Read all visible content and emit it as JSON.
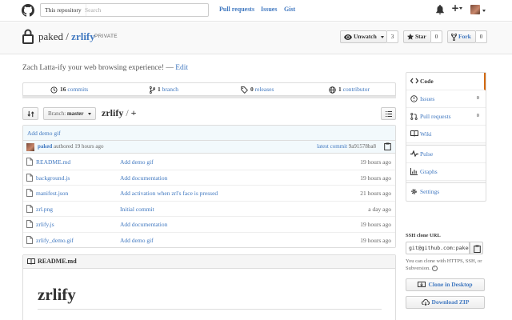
{
  "header": {
    "search_scope": "This repository",
    "search_placeholder": "Search",
    "nav": [
      "Pull requests",
      "Issues",
      "Gist"
    ]
  },
  "repo": {
    "owner": "paked",
    "separator": "/",
    "name": "zrlify",
    "visibility": "PRIVATE",
    "watch_label": "Unwatch",
    "watch_count": "3",
    "star_label": "Star",
    "star_count": "0",
    "fork_label": "Fork",
    "fork_count": "0",
    "description": "Zach Latta-ify your web browsing experience!",
    "dash": "—",
    "edit_label": "Edit"
  },
  "summary": {
    "commits_n": "16",
    "commits_label": "commits",
    "branches_n": "1",
    "branches_label": "branch",
    "releases_n": "0",
    "releases_label": "releases",
    "contributors_n": "1",
    "contributors_label": "contributor"
  },
  "filenav": {
    "branch_prefix": "Branch:",
    "branch_name": "master",
    "repo_name": "zrlify",
    "slash": "/",
    "plus": "+"
  },
  "commit": {
    "message": "Add demo gif",
    "author": "paked",
    "authored_text": "authored 19 hours ago",
    "latest_label": "latest commit",
    "sha": "9a91578ba8"
  },
  "files": [
    {
      "name": "README.md",
      "message": "Add demo gif",
      "age": "19 hours ago"
    },
    {
      "name": "background.js",
      "message": "Add documentation",
      "age": "19 hours ago"
    },
    {
      "name": "manifest.json",
      "message": "Add activation when zrl's face is pressed",
      "age": "21 hours ago"
    },
    {
      "name": "zrl.png",
      "message": "Initial commit",
      "age": "a day ago"
    },
    {
      "name": "zrlify.js",
      "message": "Add documentation",
      "age": "19 hours ago"
    },
    {
      "name": "zrlify_demo.gif",
      "message": "Add demo gif",
      "age": "19 hours ago"
    }
  ],
  "readme": {
    "file_label": "README.md",
    "heading": "zrlify"
  },
  "sidebar": {
    "items": [
      {
        "label": "Code",
        "count": ""
      },
      {
        "label": "Issues",
        "count": "0"
      },
      {
        "label": "Pull requests",
        "count": "0"
      },
      {
        "label": "Wiki",
        "count": ""
      },
      {
        "label": "Pulse",
        "count": ""
      },
      {
        "label": "Graphs",
        "count": ""
      },
      {
        "label": "Settings",
        "count": ""
      }
    ],
    "ssh_label": "SSH clone URL",
    "ssh_value": "git@github.com:paked/zrlify.git",
    "help_text": "You can clone with HTTPS, SSH, or Subversion.",
    "help_icon": "?",
    "clone_desktop": "Clone in Desktop",
    "download_zip": "Download ZIP"
  },
  "colors": {
    "link": "#4078c0",
    "selected_nav_accent": "#d26911"
  }
}
